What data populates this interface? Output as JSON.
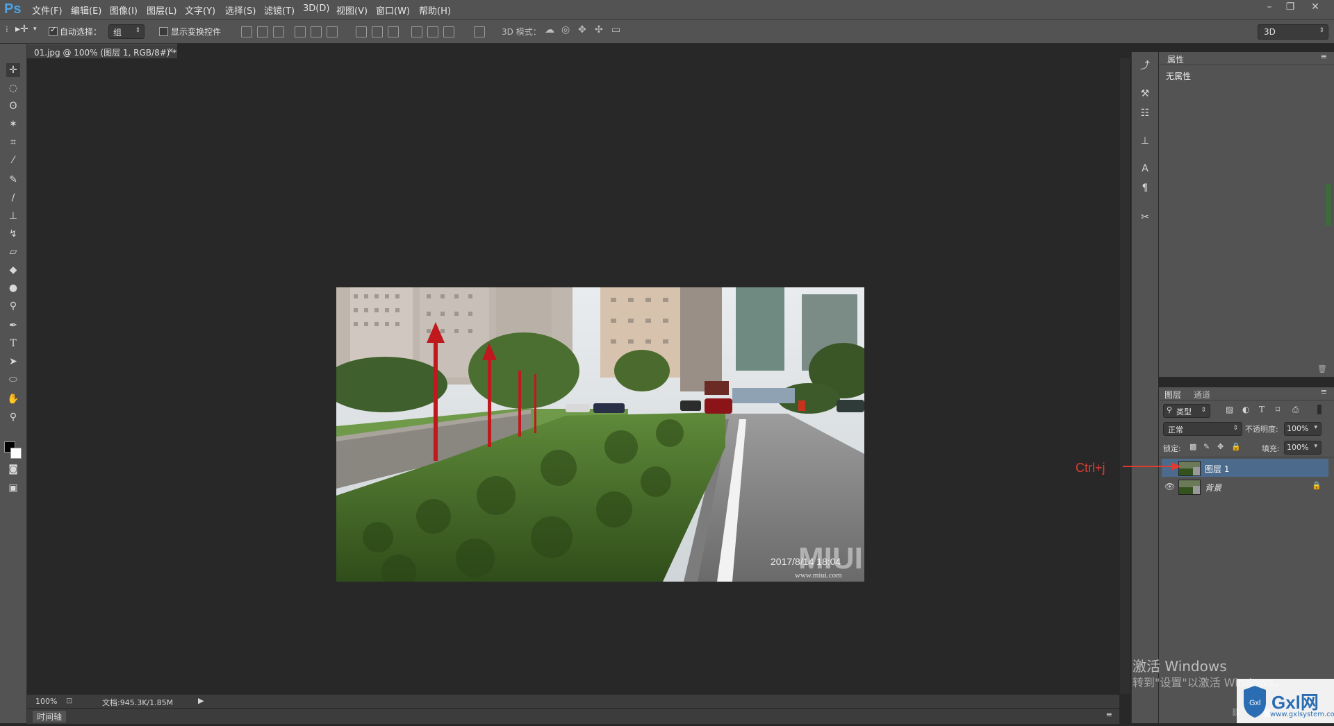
{
  "app": {
    "logo": "Ps"
  },
  "menu": [
    "文件(F)",
    "编辑(E)",
    "图像(I)",
    "图层(L)",
    "文字(Y)",
    "选择(S)",
    "滤镜(T)",
    "3D(D)",
    "视图(V)",
    "窗口(W)",
    "帮助(H)"
  ],
  "options": {
    "auto_select_label": "自动选择：",
    "auto_select_value": "组",
    "show_transform_label": "显示变换控件",
    "mode_3d_label": "3D 模式：",
    "workspace_value": "3D"
  },
  "document": {
    "tab_title": "01.jpg @ 100% (图层 1, RGB/8#) *",
    "zoom": "100%",
    "doc_info": "文档:945.3K/1.85M",
    "photo_stamp": "2017/8/14  18:04",
    "photo_watermark_site": "www.miui.com",
    "photo_watermark_brand": "MIUI"
  },
  "timeline_label": "时间轴",
  "properties": {
    "tab": "属性",
    "message": "无属性"
  },
  "layers": {
    "tabs": [
      "图层",
      "通道"
    ],
    "filter_kind": "类型",
    "blend_mode": "正常",
    "opacity_label": "不透明度:",
    "opacity_value": "100%",
    "lock_label": "锁定:",
    "fill_label": "填充:",
    "fill_value": "100%",
    "items": [
      {
        "name": "图层 1",
        "selected": true
      },
      {
        "name": "背景",
        "selected": false,
        "locked": true
      }
    ]
  },
  "annotation": "Ctrl+j",
  "activation": {
    "title": "激活 Windows",
    "subtitle": "转到\"设置\"以激活 Windows。"
  },
  "badge": {
    "text": "Gxl网",
    "site": "www.gxlsystem.com"
  },
  "colors": {
    "accent": "#4aa3e8",
    "annotation": "#e03b2f",
    "selected_layer": "#4b6a8c"
  },
  "icons": [
    "move-tool-icon",
    "marquee-icon",
    "lasso-icon",
    "magic-wand-icon",
    "crop-icon",
    "eyedropper-icon",
    "healing-brush-icon",
    "brush-icon",
    "stamp-icon",
    "history-brush-icon",
    "eraser-icon",
    "paint-bucket-icon",
    "blur-icon",
    "dodge-icon",
    "pen-icon",
    "type-icon",
    "path-select-icon",
    "ellipse-icon",
    "hand-icon",
    "zoom-icon"
  ]
}
